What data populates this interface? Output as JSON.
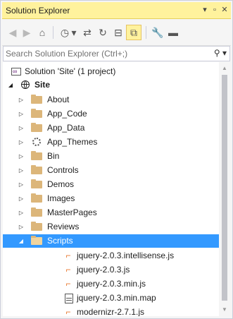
{
  "window": {
    "title": "Solution Explorer",
    "dropdown_glyph": "▾",
    "pin_glyph": "▫",
    "close_glyph": "✕"
  },
  "toolbar": {
    "buttons": [
      {
        "name": "back-icon",
        "glyph": "◀"
      },
      {
        "name": "forward-icon",
        "glyph": "▶"
      },
      {
        "name": "home-icon",
        "glyph": "⌂"
      },
      {
        "name": "pending-changes-icon",
        "glyph": "◷"
      },
      {
        "name": "dropdown-icon",
        "glyph": "▾"
      },
      {
        "name": "sync-icon",
        "glyph": "⇄"
      },
      {
        "name": "refresh-icon",
        "glyph": "↻"
      },
      {
        "name": "collapse-all-icon",
        "glyph": "⊟"
      },
      {
        "name": "show-all-files-icon",
        "glyph": "⧉"
      },
      {
        "name": "properties-icon",
        "glyph": "🔧"
      },
      {
        "name": "preview-icon",
        "glyph": "▬"
      }
    ]
  },
  "search": {
    "placeholder": "Search Solution Explorer (Ctrl+;)",
    "value": "",
    "icon_glyph": "⚲ ▾"
  },
  "tree": {
    "solution": {
      "label": "Solution 'Site' (1 project)"
    },
    "project": {
      "label": "Site",
      "expanded": true
    },
    "folders": [
      {
        "label": "About",
        "icon": "folder-icon"
      },
      {
        "label": "App_Code",
        "icon": "folder-icon"
      },
      {
        "label": "App_Data",
        "icon": "folder-icon"
      },
      {
        "label": "App_Themes",
        "icon": "theme-icon"
      },
      {
        "label": "Bin",
        "icon": "folder-icon"
      },
      {
        "label": "Controls",
        "icon": "folder-icon"
      },
      {
        "label": "Demos",
        "icon": "folder-icon"
      },
      {
        "label": "Images",
        "icon": "folder-icon"
      },
      {
        "label": "MasterPages",
        "icon": "folder-icon"
      },
      {
        "label": "Reviews",
        "icon": "folder-icon"
      },
      {
        "label": "Scripts",
        "icon": "folder-open-icon",
        "expanded": true,
        "selected": true
      }
    ],
    "scripts_files": [
      {
        "label": "jquery-2.0.3.intellisense.js",
        "icon": "js-file-icon"
      },
      {
        "label": "jquery-2.0.3.js",
        "icon": "js-file-icon"
      },
      {
        "label": "jquery-2.0.3.min.js",
        "icon": "js-file-icon"
      },
      {
        "label": "jquery-2.0.3.min.map",
        "icon": "map-file-icon"
      },
      {
        "label": "modernizr-2.7.1.js",
        "icon": "js-file-icon"
      }
    ],
    "collapsed_arrow": "▷",
    "expanded_arrow": "◢"
  },
  "colors": {
    "title_bar": "#fff29d",
    "selection": "#3399ff",
    "folder": "#dcb67a",
    "js_icon": "#e8772e"
  }
}
